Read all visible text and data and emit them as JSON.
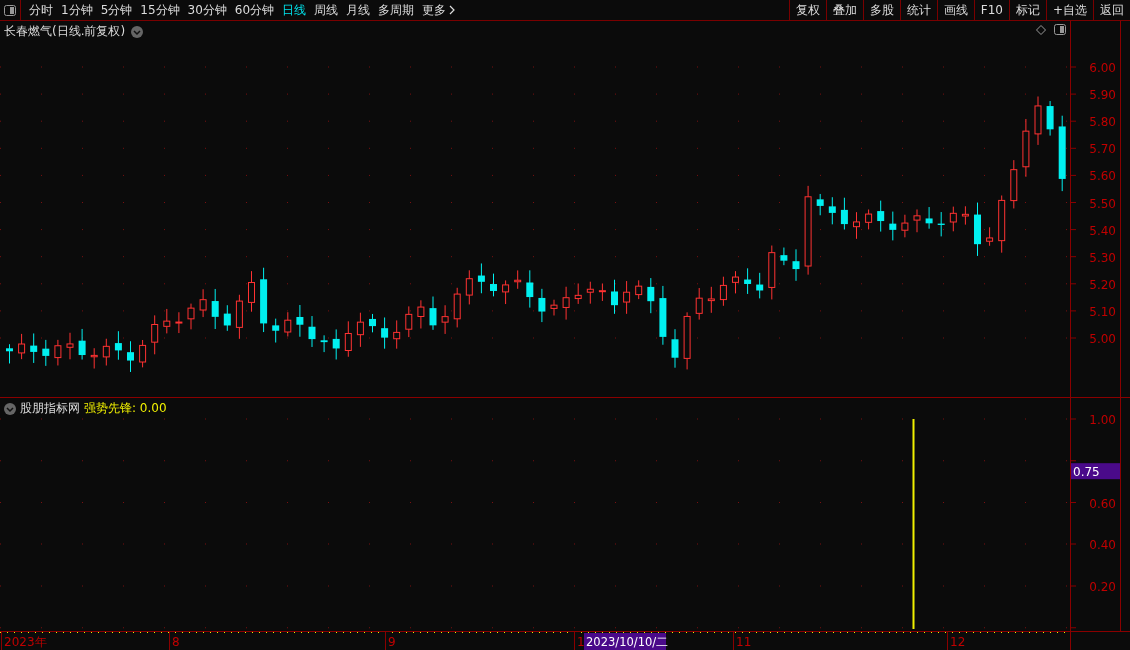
{
  "toolbar": {
    "periods": [
      {
        "label": "分时",
        "selected": false
      },
      {
        "label": "1分钟",
        "selected": false
      },
      {
        "label": "5分钟",
        "selected": false
      },
      {
        "label": "15分钟",
        "selected": false
      },
      {
        "label": "30分钟",
        "selected": false
      },
      {
        "label": "60分钟",
        "selected": false
      },
      {
        "label": "日线",
        "selected": true
      },
      {
        "label": "周线",
        "selected": false
      },
      {
        "label": "月线",
        "selected": false
      },
      {
        "label": "多周期",
        "selected": false
      }
    ],
    "more": "更多",
    "actions": [
      "复权",
      "叠加",
      "多股",
      "统计",
      "画线",
      "F10",
      "标记",
      "+自选",
      "返回"
    ]
  },
  "price_pane": {
    "title": "长春燃气(日线.前复权)",
    "y_ticks": [
      "6.00",
      "5.90",
      "5.80",
      "5.70",
      "5.60",
      "5.50",
      "5.40",
      "5.30",
      "5.20",
      "5.10",
      "5.00"
    ]
  },
  "indicator_pane": {
    "source": "股朋指标网",
    "indicator": "强势先锋: 0.00",
    "y_ticks": [
      "1.00",
      "0.60",
      "0.40",
      "0.20"
    ],
    "cursor_value": "0.75"
  },
  "time_axis": {
    "labels": [
      "2023年",
      "8",
      "9",
      "1",
      "11",
      "12"
    ],
    "cursor_date": "2023/10/10/二"
  }
}
